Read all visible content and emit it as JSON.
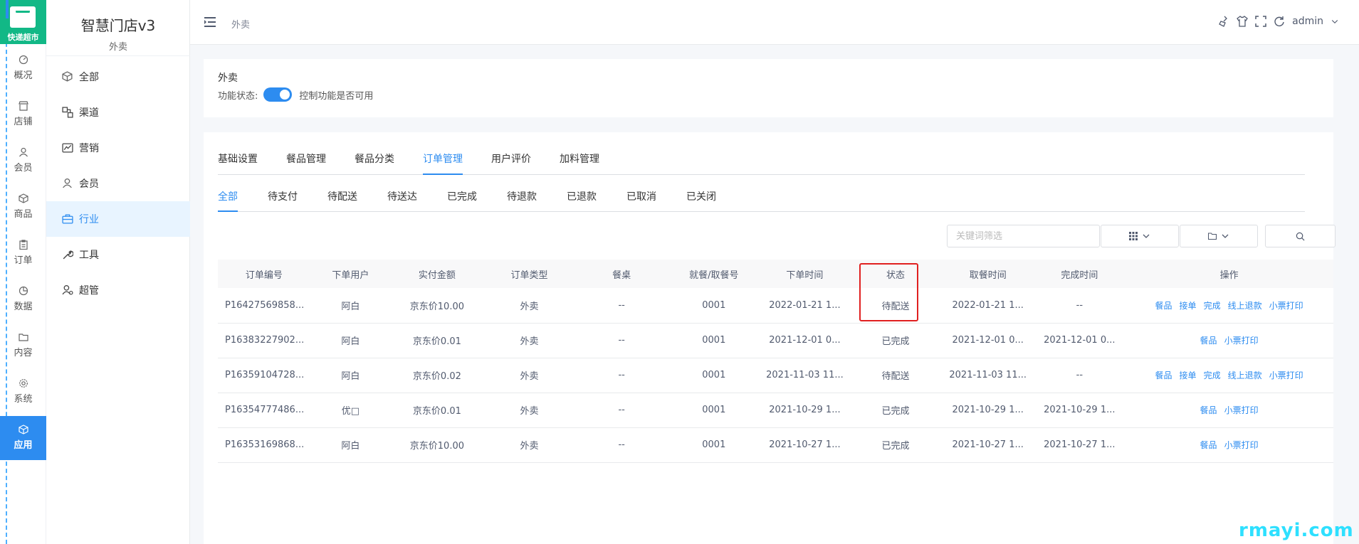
{
  "logo": {
    "text": "快递超市"
  },
  "rail": {
    "items": [
      {
        "label": "概况",
        "icon": "dashboard-icon"
      },
      {
        "label": "店铺",
        "icon": "store-icon"
      },
      {
        "label": "会员",
        "icon": "user-icon"
      },
      {
        "label": "商品",
        "icon": "cube-icon"
      },
      {
        "label": "订单",
        "icon": "clipboard-icon"
      },
      {
        "label": "数据",
        "icon": "pie-icon"
      },
      {
        "label": "内容",
        "icon": "folder-icon"
      },
      {
        "label": "系统",
        "icon": "gear-icon"
      },
      {
        "label": "应用",
        "icon": "cube-icon",
        "active": true
      }
    ]
  },
  "sidebar": {
    "title": "智慧门店v3",
    "subtitle": "外卖",
    "items": [
      {
        "label": "全部",
        "icon": "cube-icon"
      },
      {
        "label": "渠道",
        "icon": "channel-icon"
      },
      {
        "label": "营销",
        "icon": "chart-icon"
      },
      {
        "label": "会员",
        "icon": "user-icon"
      },
      {
        "label": "行业",
        "icon": "briefcase-icon",
        "active": true
      },
      {
        "label": "工具",
        "icon": "wrench-icon"
      },
      {
        "label": "超管",
        "icon": "admin-icon"
      }
    ]
  },
  "header": {
    "breadcrumb": "外卖",
    "user": "admin"
  },
  "feature": {
    "title": "外卖",
    "status_label": "功能状态:",
    "status_desc": "控制功能是否可用",
    "enabled": true
  },
  "tabs_main": [
    "基础设置",
    "餐品管理",
    "餐品分类",
    "订单管理",
    "用户评价",
    "加料管理"
  ],
  "tabs_main_active": 3,
  "tabs_status": [
    "全部",
    "待支付",
    "待配送",
    "待送达",
    "已完成",
    "待退款",
    "已退款",
    "已取消",
    "已关闭"
  ],
  "tabs_status_active": 0,
  "filters": {
    "keyword_placeholder": "关键词筛选"
  },
  "table": {
    "headers": [
      "订单编号",
      "下单用户",
      "实付金额",
      "订单类型",
      "餐桌",
      "就餐/取餐号",
      "下单时间",
      "状态",
      "取餐时间",
      "完成时间",
      "操作"
    ],
    "rows": [
      {
        "cells": [
          "P16427569858...",
          "阿白",
          "京东价10.00",
          "外卖",
          "--",
          "0001",
          "2022-01-21 1...",
          "待配送",
          "2022-01-21 1...",
          "--"
        ],
        "actions": [
          "餐品",
          "接单",
          "完成",
          "线上退款",
          "小票打印"
        ]
      },
      {
        "cells": [
          "P16383227902...",
          "阿白",
          "京东价0.01",
          "外卖",
          "--",
          "0001",
          "2021-12-01 0...",
          "已完成",
          "2021-12-01 0...",
          "2021-12-01 0..."
        ],
        "actions": [
          "餐品",
          "小票打印"
        ]
      },
      {
        "cells": [
          "P16359104728...",
          "阿白",
          "京东价0.02",
          "外卖",
          "--",
          "0001",
          "2021-11-03 11...",
          "待配送",
          "2021-11-03 11...",
          "--"
        ],
        "actions": [
          "餐品",
          "接单",
          "完成",
          "线上退款",
          "小票打印"
        ]
      },
      {
        "cells": [
          "P16354777486...",
          "优□",
          "京东价0.01",
          "外卖",
          "--",
          "0001",
          "2021-10-29 1...",
          "已完成",
          "2021-10-29 1...",
          "2021-10-29 1..."
        ],
        "actions": [
          "餐品",
          "小票打印"
        ]
      },
      {
        "cells": [
          "P16353169868...",
          "阿白",
          "京东价10.00",
          "外卖",
          "--",
          "0001",
          "2021-10-27 1...",
          "已完成",
          "2021-10-27 1...",
          "2021-10-27 1..."
        ],
        "actions": [
          "餐品",
          "小票打印"
        ]
      }
    ]
  },
  "watermark": "rmayi.com",
  "colors": {
    "accent": "#2d8cf0",
    "logo_bg": "#12b886",
    "highlight": "#e02020",
    "watermark": "#2ee0ff"
  }
}
